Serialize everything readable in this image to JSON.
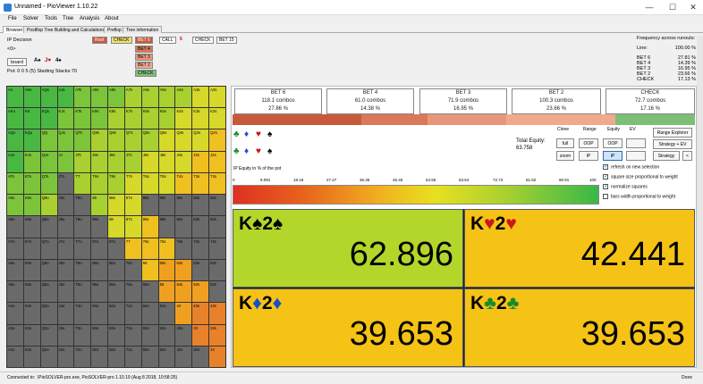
{
  "window": {
    "title": "Unnamed - PioViewer 1.10.22",
    "minimize": "—",
    "maximize": "☐",
    "close": "✕"
  },
  "menu": [
    "File",
    "Solver",
    "Tools",
    "Tree",
    "Analysis",
    "About"
  ],
  "tabs": [
    {
      "label": "Browser",
      "active": true
    },
    {
      "label": "Postflop Tree Building and Calculations",
      "active": false
    },
    {
      "label": "Preflop",
      "active": false
    },
    {
      "label": "Tree information",
      "active": false
    }
  ],
  "sidebar": {
    "decision": "IP Decision",
    "line": "<0>",
    "board_button": "board",
    "board_cards": [
      {
        "rank": "A",
        "suit": "♠",
        "color": "#000000"
      },
      {
        "rank": "J",
        "suit": "♥",
        "color": "#cc0000"
      },
      {
        "rank": "4",
        "suit": "♠",
        "color": "#000000"
      }
    ],
    "pot": "Pot: 0 0 5 (5) Starting Stacks:70"
  },
  "line_buttons": {
    "root": "Root",
    "check": "CHECK",
    "call": "CALL",
    "five": "5",
    "check2": "CHECK",
    "bet15": "BET 15"
  },
  "line_options": [
    "BET 6",
    "BET 4",
    "BET 3",
    "BET 2",
    "CHECK"
  ],
  "summary": {
    "title": "Frequency across runouts:",
    "rows": [
      {
        "k": "Line:",
        "v": "100.00 %"
      },
      {
        "k": "BET 6",
        "v": "27.81 %"
      },
      {
        "k": "BET 4",
        "v": "14.39 %"
      },
      {
        "k": "BET 3",
        "v": "16.95 %"
      },
      {
        "k": "BET 2",
        "v": "23.66 %"
      },
      {
        "k": "CHECK",
        "v": "17.13 %"
      }
    ]
  },
  "actions": [
    {
      "name": "BET 6",
      "combos": "118.1 combos",
      "pct": "27.86 %",
      "color": "#c85a3c"
    },
    {
      "name": "BET 4",
      "combos": "61.0 combos",
      "pct": "14.38 %",
      "color": "#d9785a"
    },
    {
      "name": "BET 3",
      "combos": "71.9 combos",
      "pct": "16.95 %",
      "color": "#e8967a"
    },
    {
      "name": "BET 2",
      "combos": "100.3 combos",
      "pct": "23.66 %",
      "color": "#f0a98c"
    },
    {
      "name": "CHECK",
      "combos": "72.7 combos",
      "pct": "17.16 %",
      "color": "#7cbf76"
    }
  ],
  "action_share": [
    27.86,
    14.38,
    16.95,
    23.66,
    17.16
  ],
  "suit_selector": [
    {
      "s": "♣",
      "c": "#1a8a2a"
    },
    {
      "s": "♦",
      "c": "#1a4fc8"
    },
    {
      "s": "♥",
      "c": "#d01010"
    },
    {
      "s": "♠",
      "c": "#000000"
    },
    {
      "s": "♣",
      "c": "#1a8a2a"
    },
    {
      "s": "♦",
      "c": "#1a4fc8"
    },
    {
      "s": "♥",
      "c": "#d01010"
    },
    {
      "s": "♠",
      "c": "#000000"
    }
  ],
  "equity_label": "IP Equity in % of the pot",
  "scale_ticks": [
    "0",
    "9.091",
    "18.18",
    "27.27",
    "36.36",
    "45.45",
    "54.55",
    "63.64",
    "72.73",
    "81.82",
    "90.91",
    "100"
  ],
  "total_equity": {
    "label": "Total Equity:",
    "value": "63.758"
  },
  "controls": {
    "headers": [
      "Clone",
      "Range",
      "Equity",
      "EV"
    ],
    "full": "full",
    "zoom": "zoom",
    "oop1": "OOP",
    "ip1": "IP",
    "oop2": "OOP",
    "ip2": "IP",
    "range_explorer": "Range Explorer",
    "strategy_ev": "Strategy + EV",
    "strategy": "Strategy",
    "small": "<"
  },
  "checkboxes": [
    {
      "label": "refresh on new selection",
      "checked": true
    },
    {
      "label": "square size proportional to weight",
      "checked": true
    },
    {
      "label": "normalize squares",
      "checked": true
    },
    {
      "label": "bars width proportional to weight",
      "checked": false
    }
  ],
  "combos": [
    {
      "rank": "K",
      "suit": "♠",
      "kicker": "2",
      "suit2": "♠",
      "suit_color": "#000000",
      "value": "62.896",
      "bg": "#b3d62a"
    },
    {
      "rank": "K",
      "suit": "♥",
      "kicker": "2",
      "suit2": "♥",
      "suit_color": "#c81818",
      "value": "42.441",
      "bg": "#f5c216"
    },
    {
      "rank": "K",
      "suit": "♦",
      "kicker": "2",
      "suit2": "♦",
      "suit_color": "#1a4fc8",
      "value": "39.653",
      "bg": "#f5c216"
    },
    {
      "rank": "K",
      "suit": "♣",
      "kicker": "2",
      "suit2": "♣",
      "suit_color": "#1a8a2a",
      "value": "39.653",
      "bg": "#f5c216"
    }
  ],
  "ranks": [
    "A",
    "K",
    "Q",
    "J",
    "T",
    "9",
    "8",
    "7",
    "6",
    "5",
    "4",
    "3",
    "2"
  ],
  "status": {
    "left": "Connected to: .\\PioSOLVER-pro.exe, PioSOLVER-pro 1.10.19 (Aug 8 2018, 10:58:25)",
    "right": "Done"
  }
}
